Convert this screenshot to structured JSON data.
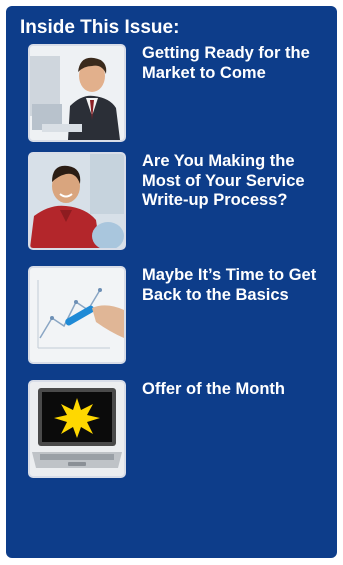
{
  "newsletter": {
    "heading": "Inside This Issue:",
    "articles": [
      {
        "title": "Getting Ready for the Market to Come",
        "image": "businessman-at-computer-icon"
      },
      {
        "title": "Are You Making the Most of Your Service Write-up Process?",
        "image": "smiling-man-red-shirt-icon"
      },
      {
        "title": "Maybe It’s Time to Get Back to the Basics",
        "image": "chart-presentation-icon"
      },
      {
        "title": "Offer of the Month",
        "image": "laptop-starburst-icon"
      }
    ]
  },
  "colors": {
    "panel": "#0d3d8a",
    "text": "#ffffff",
    "starburst": "#ffd800"
  }
}
